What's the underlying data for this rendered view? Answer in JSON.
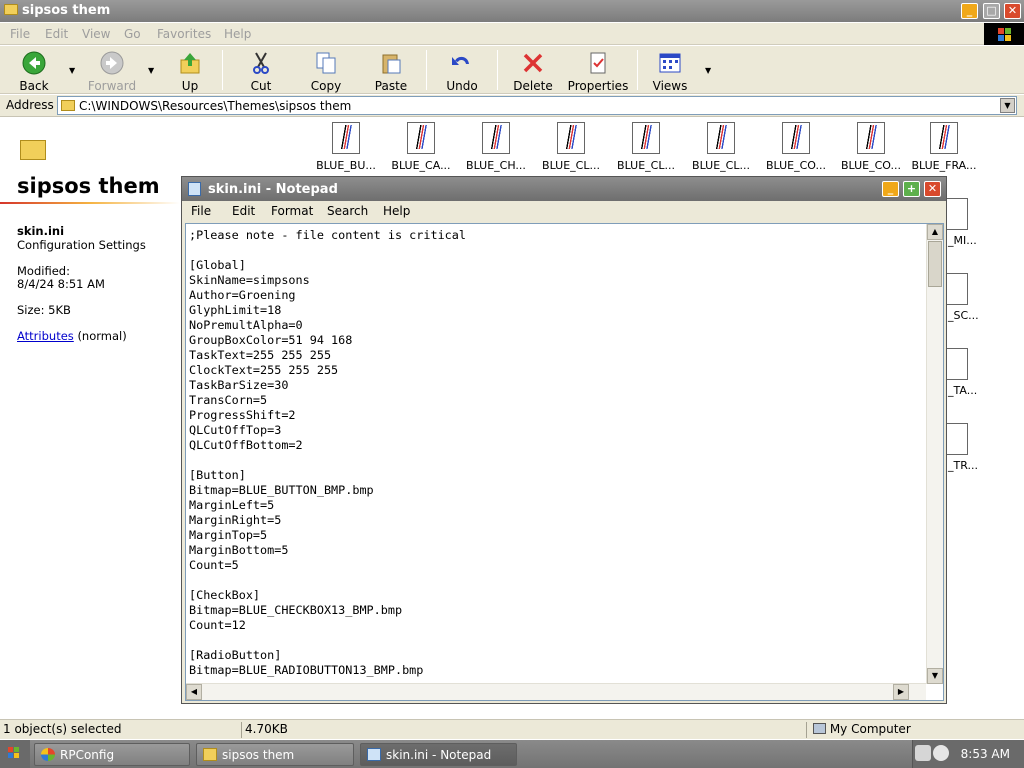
{
  "explorer": {
    "title": "sipsos them",
    "menu": [
      "File",
      "Edit",
      "View",
      "Go",
      "Favorites",
      "Help"
    ],
    "toolbar": {
      "back": "Back",
      "forward": "Forward",
      "up": "Up",
      "cut": "Cut",
      "copy": "Copy",
      "paste": "Paste",
      "undo": "Undo",
      "delete": "Delete",
      "properties": "Properties",
      "views": "Views"
    },
    "address": {
      "label": "Address",
      "value": "C:\\WINDOWS\\Resources\\Themes\\sipsos them"
    }
  },
  "left_panel": {
    "folder_title": "sipsos them",
    "file_name": "skin.ini",
    "file_type": "Configuration Settings",
    "modified_label": "Modified:",
    "modified_value": "8/4/24 8:51 AM",
    "size": "Size: 5KB",
    "attributes_link": "Attributes",
    "attributes_value": "(normal)"
  },
  "files": [
    "BLUE_BU...",
    "BLUE_CA...",
    "BLUE_CH...",
    "BLUE_CL...",
    "BLUE_CL...",
    "BLUE_CL...",
    "BLUE_CO...",
    "BLUE_CO...",
    "BLUE_FRA..."
  ],
  "files_clipped": [
    "_MI...",
    "_SC...",
    "_TA...",
    "_TR..."
  ],
  "notepad": {
    "title": "skin.ini - Notepad",
    "menu": [
      "File",
      "Edit",
      "Format",
      "Search",
      "Help"
    ],
    "content": ";Please note - file content is critical\n\n[Global]\nSkinName=simpsons\nAuthor=Groening\nGlyphLimit=18\nNoPremultAlpha=0\nGroupBoxColor=51 94 168\nTaskText=255 255 255\nClockText=255 255 255\nTaskBarSize=30\nTransCorn=5\nProgressShift=2\nQLCutOffTop=3\nQLCutOffBottom=2\n\n[Button]\nBitmap=BLUE_BUTTON_BMP.bmp\nMarginLeft=5\nMarginRight=5\nMarginTop=5\nMarginBottom=5\nCount=5\n\n[CheckBox]\nBitmap=BLUE_CHECKBOX13_BMP.bmp\nCount=12\n\n[RadioButton]\nBitmap=BLUE_RADIOBUTTON13_BMP.bmp"
  },
  "status": {
    "selection": "1 object(s) selected",
    "size": "4.70KB",
    "zone": "My Computer"
  },
  "taskbar": {
    "tasks": [
      "RPConfig",
      "sipsos them",
      "skin.ini - Notepad"
    ],
    "clock": "8:53 AM"
  },
  "colors": {
    "title_bar": "#8a8a8a",
    "accent_minimize": "#f0a819",
    "accent_close": "#d94a2c",
    "link": "#0000cc"
  }
}
